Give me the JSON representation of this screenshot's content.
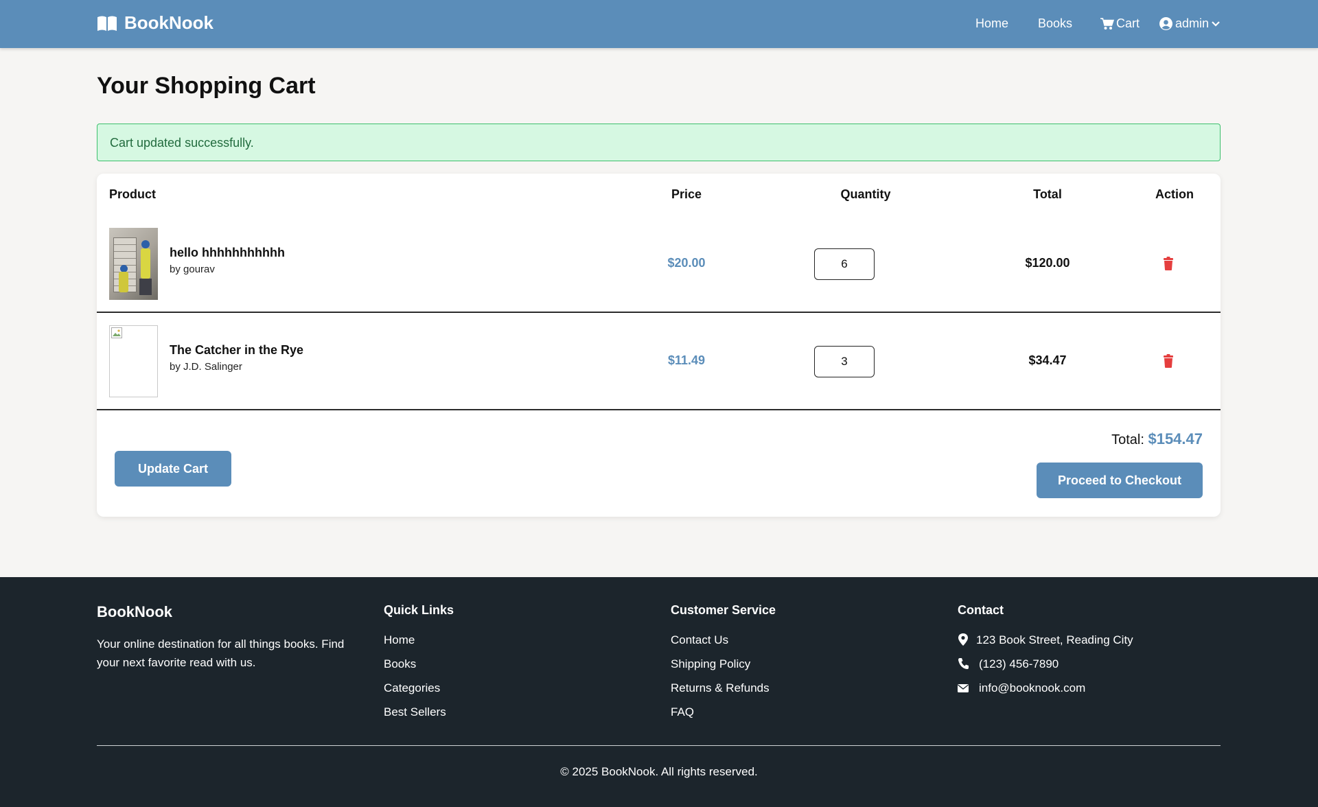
{
  "nav": {
    "brand": "BookNook",
    "home": "Home",
    "books": "Books",
    "cart": "Cart",
    "user": "admin"
  },
  "page": {
    "title": "Your Shopping Cart",
    "alert": "Cart updated successfully."
  },
  "cart": {
    "headers": {
      "product": "Product",
      "price": "Price",
      "quantity": "Quantity",
      "total": "Total",
      "action": "Action"
    },
    "items": [
      {
        "title": "hello hhhhhhhhhhh",
        "author": "by gourav",
        "price": "$20.00",
        "quantity": "6",
        "total": "$120.00"
      },
      {
        "title": "The Catcher in the Rye",
        "author": "by J.D. Salinger",
        "price": "$11.49",
        "quantity": "3",
        "total": "$34.47"
      }
    ],
    "grand_total_label": "Total:",
    "grand_total_value": "$154.47",
    "update_label": "Update Cart",
    "checkout_label": "Proceed to Checkout"
  },
  "footer": {
    "brand": "BookNook",
    "description": "Your online destination for all things books. Find your next favorite read with us.",
    "quick_links": {
      "heading": "Quick Links",
      "items": [
        "Home",
        "Books",
        "Categories",
        "Best Sellers"
      ]
    },
    "customer_service": {
      "heading": "Customer Service",
      "items": [
        "Contact Us",
        "Shipping Policy",
        "Returns & Refunds",
        "FAQ"
      ]
    },
    "contact": {
      "heading": "Contact",
      "address": "123 Book Street, Reading City",
      "phone": "(123) 456-7890",
      "email": "info@booknook.com"
    },
    "copyright": "© 2025 BookNook. All rights reserved."
  },
  "colors": {
    "primary": "#5b8db9",
    "danger": "#e53e3e",
    "footer_bg": "#1c252c",
    "success_bg": "#d6f8e2"
  }
}
